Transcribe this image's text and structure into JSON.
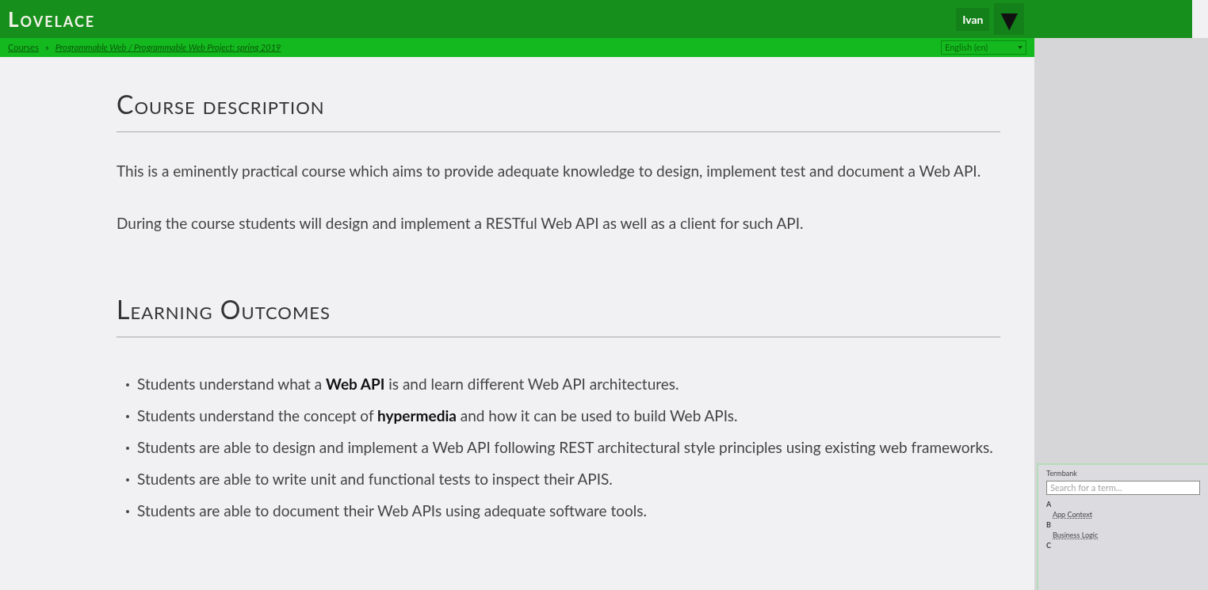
{
  "header": {
    "logo": "Lovelace",
    "user": "Ivan",
    "menu_toggle": "▼"
  },
  "breadcrumb": {
    "items": [
      "Courses",
      "Programmable Web / Programmable Web Project: spring 2019"
    ],
    "separator": "»"
  },
  "language_select": {
    "value": "English (en)"
  },
  "sections": [
    {
      "heading": "Course description",
      "paragraphs": [
        "This is a eminently practical course which aims to provide adequate knowledge to design, implement test and document a Web API.",
        "During the course students will design and implement a RESTful Web API as well as a client for such API."
      ]
    },
    {
      "heading": "Learning Outcomes",
      "bullets": [
        "Students understand what a **Web API** is and learn different Web API architectures.",
        "Students understand the concept of **hypermedia** and how it can be used to build Web APIs.",
        "Students are able to design and implement a Web API following REST architectural style principles using existing web frameworks.",
        "Students are able to write unit and functional tests to inspect their APIS.",
        "Students are able to document their Web APIs using adequate software tools."
      ]
    }
  ],
  "termbank": {
    "title": "Termbank",
    "placeholder": "Search for a term...",
    "groups": [
      {
        "letter": "A",
        "terms": [
          "App Context"
        ]
      },
      {
        "letter": "B",
        "terms": [
          "Business Logic"
        ]
      },
      {
        "letter": "C"
      }
    ]
  }
}
